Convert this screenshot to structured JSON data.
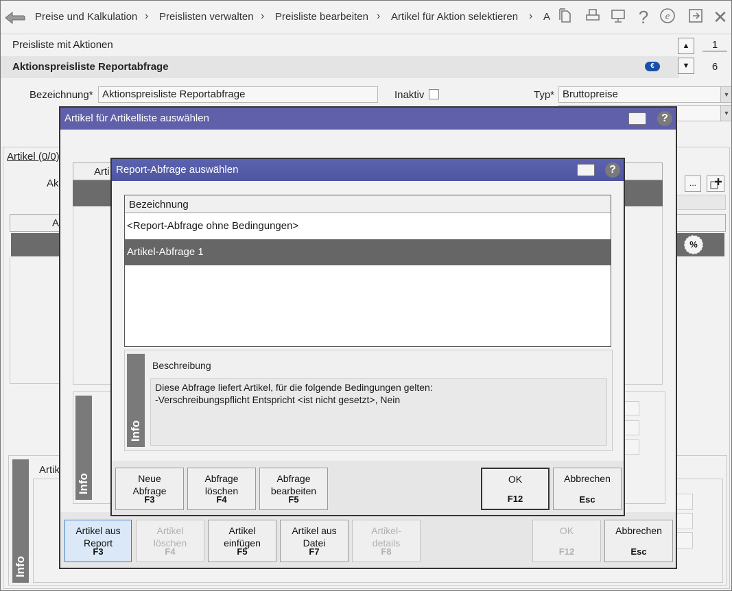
{
  "breadcrumb": {
    "items": [
      "Preise und Kalkulation",
      "Preislisten verwalten",
      "Preisliste bearbeiten",
      "Artikel für Aktion selektieren",
      "A"
    ]
  },
  "toolbar_icons": [
    "document-icon",
    "print-icon",
    "monitor-icon",
    "help-icon",
    "e-icon",
    "exit-icon",
    "close-icon"
  ],
  "page": {
    "section_title": "Preisliste mit Aktionen",
    "record_title": "Aktionspreisliste Reportabfrage",
    "counter_top": "1",
    "counter_bottom": "6",
    "bezeichnung_label": "Bezeichnung*",
    "bezeichnung_value": "Aktionspreisliste Reportabfrage",
    "inaktiv_label": "Inaktiv",
    "typ_label": "Typ*",
    "typ_value": "Bruttopreise",
    "artikel_tab": "Artikel (0/0)",
    "ak_label": "Ak",
    "a_col": "A",
    "dots_label": "...",
    "percent_label": "%",
    "artik_label": "Artik",
    "info_label": "Info"
  },
  "outer_dialog": {
    "title": "Artikel für Artikelliste auswählen",
    "col_header": "Arti",
    "info_label": "Info",
    "buttons": [
      {
        "label": "Artikel aus Report",
        "key": "F3",
        "enabled": true
      },
      {
        "label": "Artikel löschen",
        "key": "F4",
        "enabled": false
      },
      {
        "label": "Artikel einfügen",
        "key": "F5",
        "enabled": true
      },
      {
        "label": "Artikel aus Datei",
        "key": "F7",
        "enabled": true
      },
      {
        "label": "Artikel-details",
        "key": "F8",
        "enabled": false
      }
    ],
    "ok_label": "OK",
    "ok_key": "F12",
    "cancel_label": "Abbrechen",
    "cancel_key": "Esc"
  },
  "inner_dialog": {
    "title": "Report-Abfrage auswählen",
    "list_header": "Bezeichnung",
    "rows": [
      "<Report-Abfrage ohne Bedingungen>",
      "Artikel-Abfrage 1"
    ],
    "selected_row": 1,
    "desc_label": "Beschreibung",
    "desc_line1": "Diese Abfrage liefert Artikel, für die folgende Bedingungen gelten:",
    "desc_line2": "-Verschreibungspflicht Entspricht <ist nicht gesetzt>, Nein",
    "info_label": "Info",
    "buttons": [
      {
        "label": "Neue Abfrage",
        "key": "F3"
      },
      {
        "label": "Abfrage löschen",
        "key": "F4"
      },
      {
        "label": "Abfrage bearbeiten",
        "key": "F5"
      }
    ],
    "ok_label": "OK",
    "ok_key": "F12",
    "cancel_label": "Abbrechen",
    "cancel_key": "Esc"
  },
  "colors": {
    "title_bar": "#5a5fa8",
    "selected_row": "#666666",
    "focus_button": "#dbe8f7"
  }
}
